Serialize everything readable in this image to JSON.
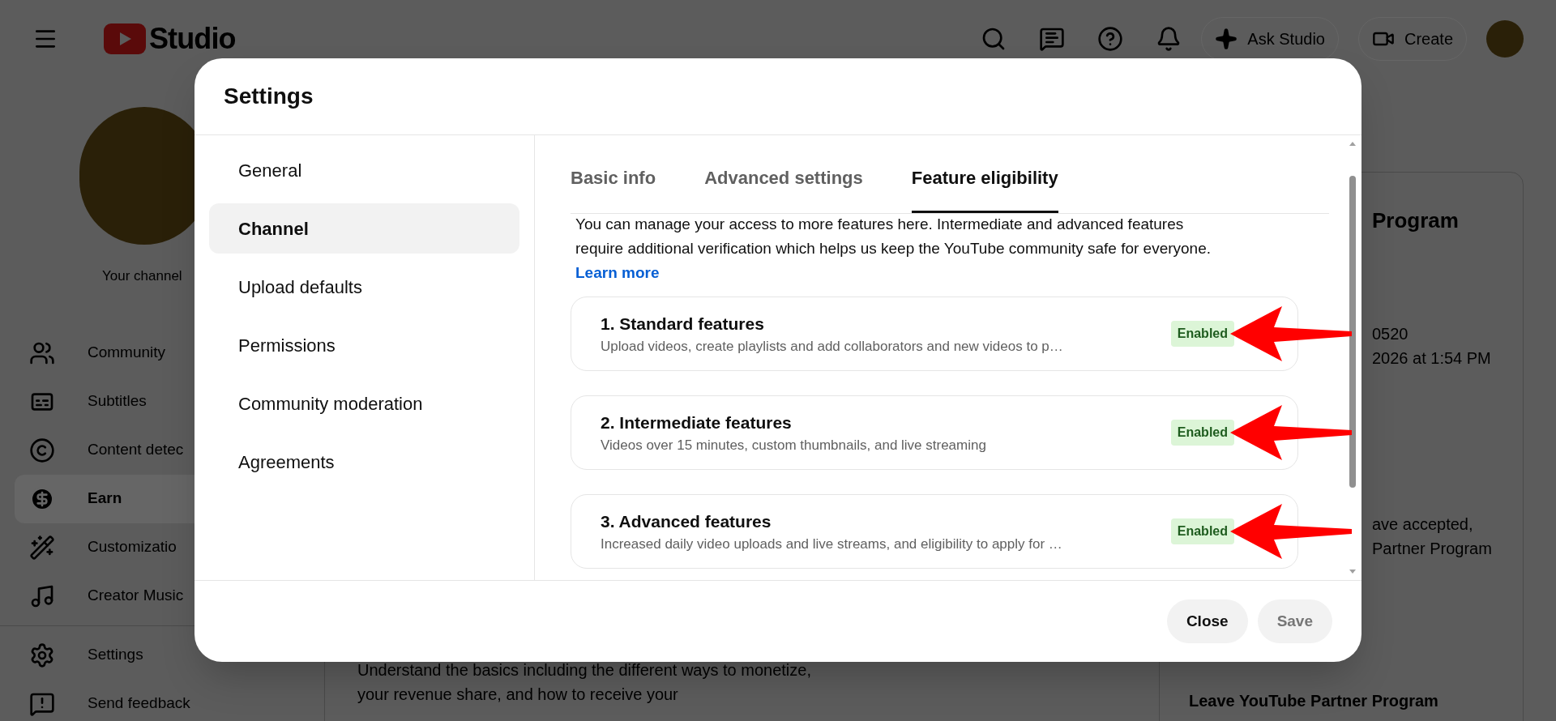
{
  "topbar": {
    "logo_text": "Studio",
    "ask_button": "Ask Studio",
    "create_button": "Create"
  },
  "sidebar": {
    "channel_label": "Your channel",
    "items": [
      {
        "kind": "community",
        "label": "Community",
        "selected": false
      },
      {
        "kind": "subtitles",
        "label": "Subtitles",
        "selected": false
      },
      {
        "kind": "copyright",
        "label": "Content detec",
        "selected": false
      },
      {
        "kind": "earn",
        "label": "Earn",
        "selected": true
      },
      {
        "kind": "customization",
        "label": "Customizatio",
        "selected": false
      },
      {
        "kind": "music",
        "label": "Creator Music",
        "selected": false
      },
      {
        "kind": "settings",
        "label": "Settings",
        "selected": false
      },
      {
        "kind": "feedback",
        "label": "Send feedback",
        "selected": false
      }
    ]
  },
  "center": {
    "text": "Understand the basics including the different ways to monetize, your revenue share, and how to receive your"
  },
  "right_panel": {
    "title": "Program",
    "lines": [
      "0520",
      "2026 at 1:54 PM"
    ],
    "note_lines": [
      "ave accepted,",
      "Partner Program"
    ],
    "leave_link": "Leave YouTube Partner Program"
  },
  "dialog": {
    "title": "Settings",
    "nav": [
      {
        "label": "General",
        "selected": false
      },
      {
        "label": "Channel",
        "selected": true
      },
      {
        "label": "Upload defaults",
        "selected": false
      },
      {
        "label": "Permissions",
        "selected": false
      },
      {
        "label": "Community moderation",
        "selected": false
      },
      {
        "label": "Agreements",
        "selected": false
      }
    ],
    "tabs": [
      {
        "label": "Basic info",
        "selected": false
      },
      {
        "label": "Advanced settings",
        "selected": false
      },
      {
        "label": "Feature eligibility",
        "selected": true
      }
    ],
    "intro": {
      "text": "You can manage your access to more features here. Intermediate and advanced features require additional verification which helps us keep the YouTube community safe for everyone.",
      "link": "Learn more"
    },
    "features": [
      {
        "title": "1. Standard features",
        "description": "Upload videos, create playlists and add collaborators and new videos to p…",
        "status": "Enabled",
        "enabled": true,
        "arrow": true
      },
      {
        "title": "2. Intermediate features",
        "description": "Videos over 15 minutes, custom thumbnails, and live streaming",
        "status": "Enabled",
        "enabled": true,
        "arrow": true
      },
      {
        "title": "3. Advanced features",
        "description": "Increased daily video uploads and live streams, and eligibility to apply for …",
        "status": "Enabled",
        "enabled": true,
        "arrow": true
      }
    ],
    "buttons": [
      {
        "label": "Close",
        "disabled": false
      },
      {
        "label": "Save",
        "disabled": true
      }
    ]
  }
}
